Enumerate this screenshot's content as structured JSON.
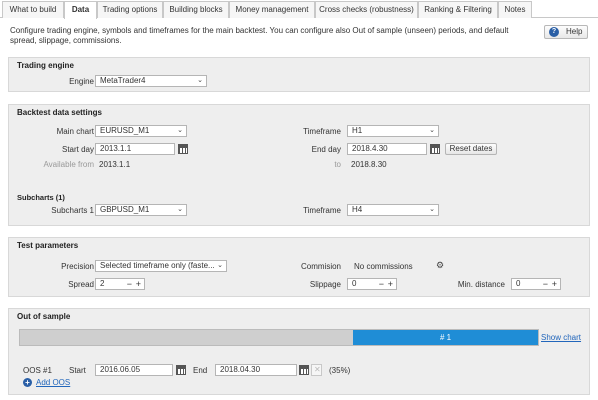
{
  "tabs": [
    {
      "label": "What to build"
    },
    {
      "label": "Data"
    },
    {
      "label": "Trading options"
    },
    {
      "label": "Building blocks"
    },
    {
      "label": "Money management"
    },
    {
      "label": "Cross checks (robustness)"
    },
    {
      "label": "Ranking & Filtering"
    },
    {
      "label": "Notes"
    }
  ],
  "description": "Configure trading engine, symbols and timeframes for the main backtest. You can configure also Out of sample (unseen) periods, and default spread, slippage, commissions.",
  "help_label": "Help",
  "trading_engine": {
    "title": "Trading engine",
    "engine_label": "Engine",
    "engine_value": "MetaTrader4"
  },
  "backtest": {
    "title": "Backtest data settings",
    "main_chart_label": "Main chart",
    "main_chart_value": "EURUSD_M1",
    "timeframe_label": "Timeframe",
    "timeframe_value": "H1",
    "start_day_label": "Start day",
    "start_day_value": "2013.1.1",
    "end_day_label": "End day",
    "end_day_value": "2018.4.30",
    "reset_dates_label": "Reset dates",
    "available_from_label": "Available from",
    "available_from_value": "2013.1.1",
    "to_label": "to",
    "to_value": "2018.8.30",
    "subcharts_title": "Subcharts (1)",
    "subcharts1_label": "Subcharts 1",
    "subcharts1_value": "GBPUSD_M1",
    "sub_timeframe_label": "Timeframe",
    "sub_timeframe_value": "H4"
  },
  "test_params": {
    "title": "Test parameters",
    "precision_label": "Precision",
    "precision_value": "Selected timeframe only (faste...",
    "commission_label": "Commision",
    "commission_value": "No commissions",
    "spread_label": "Spread",
    "spread_value": "2",
    "slippage_label": "Slippage",
    "slippage_value": "0",
    "min_distance_label": "Min. distance",
    "min_distance_value": "0"
  },
  "oos": {
    "title": "Out of sample",
    "segment_label": "# 1",
    "segment_start_fraction": 0.643,
    "show_chart_label": "Show chart",
    "row_label": "OOS #1",
    "start_label": "Start",
    "start_value": "2016.06.05",
    "end_label": "End",
    "end_value": "2018.04.30",
    "percent": "(35%)",
    "add_oos_label": "Add OOS"
  },
  "colors": {
    "accent": "#1f8dd6",
    "panel_bg": "#eeeeee",
    "link": "#2266bb"
  }
}
